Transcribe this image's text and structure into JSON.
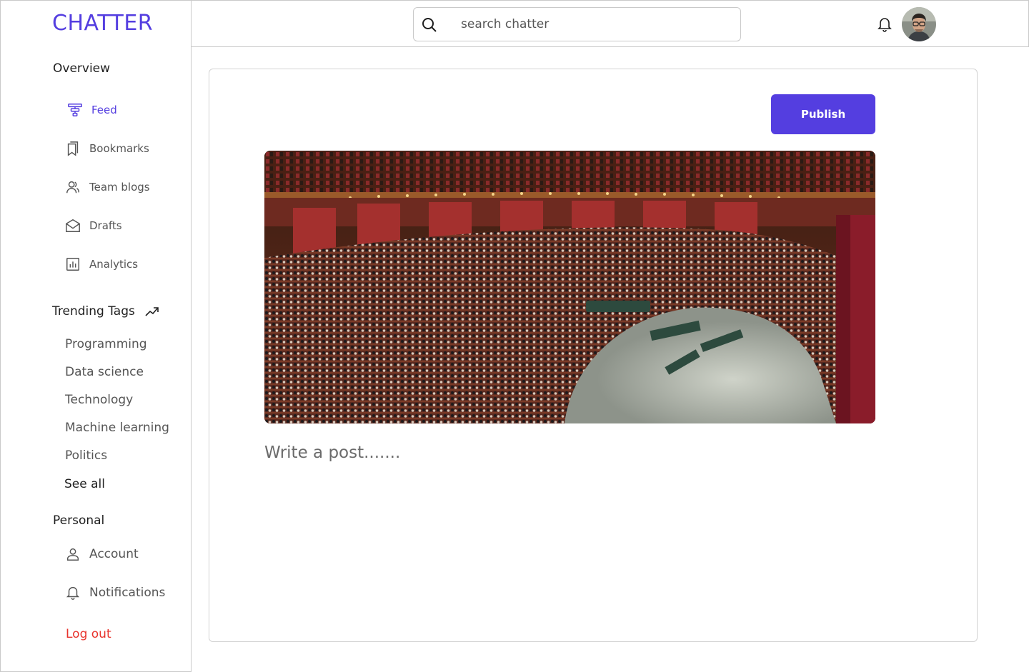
{
  "app": {
    "logo": "CHATTER"
  },
  "sidebar": {
    "overview_title": "Overview",
    "items": [
      {
        "label": "Feed",
        "icon": "feed-icon",
        "active": true
      },
      {
        "label": "Bookmarks",
        "icon": "bookmark-icon"
      },
      {
        "label": "Team blogs",
        "icon": "team-icon"
      },
      {
        "label": "Drafts",
        "icon": "drafts-icon"
      },
      {
        "label": "Analytics",
        "icon": "analytics-icon"
      }
    ],
    "trending_title": "Trending Tags",
    "tags": [
      "Programming",
      "Data science",
      "Technology",
      "Machine learning",
      "Politics"
    ],
    "see_all": "See all",
    "personal_title": "Personal",
    "personal_items": [
      {
        "label": "Account",
        "icon": "user-icon"
      },
      {
        "label": "Notifications",
        "icon": "bell-icon"
      }
    ],
    "logout": "Log out"
  },
  "header": {
    "search_placeholder": "search chatter",
    "search_icon": "search-icon",
    "notification_icon": "bell-icon",
    "avatar": "user-avatar"
  },
  "editor": {
    "publish_label": "Publish",
    "post_placeholder": "Write a post.......",
    "cover_image": "parliament-chamber-photo"
  },
  "colors": {
    "accent": "#543ee0",
    "logout": "#e8332c",
    "border": "#c9c9c9"
  }
}
